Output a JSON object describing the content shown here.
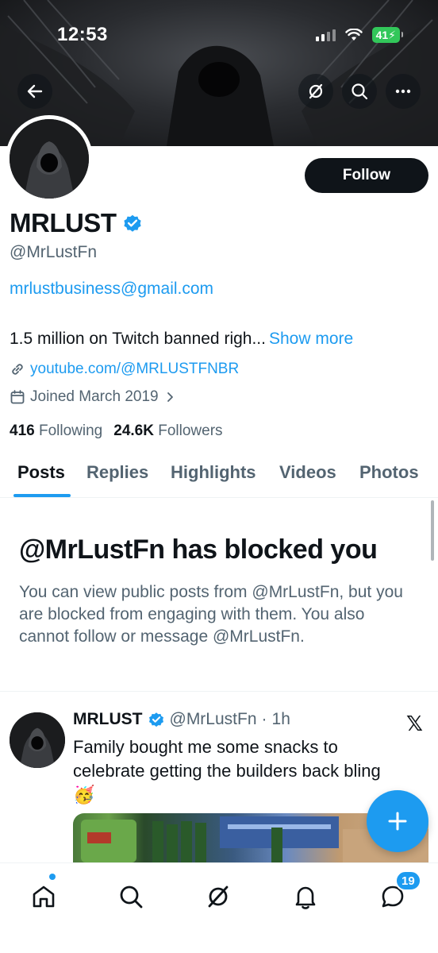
{
  "status_bar": {
    "time": "12:53",
    "battery": "41"
  },
  "profile": {
    "name": "MRLUST",
    "handle": "@MrLustFn",
    "email": "mrlustbusiness@gmail.com",
    "bio": "1.5 million on Twitch banned righ...",
    "show_more": "Show more",
    "link": "youtube.com/@MRLUSTFNBR",
    "joined": "Joined March 2019",
    "following_count": "416",
    "following_label": "Following",
    "followers_count": "24.6K",
    "followers_label": "Followers",
    "follow_button": "Follow"
  },
  "tabs": [
    {
      "label": "Posts",
      "active": true
    },
    {
      "label": "Replies"
    },
    {
      "label": "Highlights"
    },
    {
      "label": "Videos"
    },
    {
      "label": "Photos"
    }
  ],
  "blocked": {
    "title": "@MrLustFn has blocked you",
    "text": "You can view public posts from @MrLustFn, but you are blocked from engaging with them. You also cannot follow or message @MrLustFn."
  },
  "post": {
    "name": "MRLUST",
    "handle": "@MrLustFn",
    "separator": "·",
    "time": "1h",
    "text": "Family bought me some snacks to celebrate getting the builders back bling",
    "emoji": "🥳"
  },
  "bottom_nav": {
    "messages_badge": "19"
  },
  "icons": {
    "back": "arrow-left-icon",
    "grok": "grok-icon",
    "search": "search-icon",
    "more": "more-dots-icon",
    "verified": "verified-badge-icon",
    "link": "link-icon",
    "calendar": "calendar-icon",
    "chevron": "chevron-right-icon",
    "x_logo": "x-logo-icon",
    "compose": "plus-icon",
    "home": "home-icon",
    "notifications": "bell-icon",
    "messages": "chat-bubble-icon"
  },
  "colors": {
    "accent": "#1d9bf0",
    "text": "#0f1419",
    "secondary": "#536471",
    "battery": "#32c75a"
  }
}
